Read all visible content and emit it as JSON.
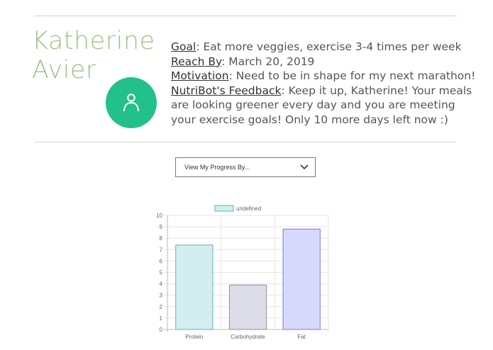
{
  "profile": {
    "first_name": "Katherine",
    "last_name": "Avier",
    "avatar_icon": "user-icon"
  },
  "info": {
    "goal_label": "Goal",
    "goal_value": ": Eat more veggies, exercise 3-4 times per week",
    "reach_label": "Reach By",
    "reach_value": ": March 20, 2019",
    "motivation_label": "Motivation",
    "motivation_value": ": Need to be in shape for my next marathon!",
    "feedback_label": "NutriBot's Feedback",
    "feedback_line1": ": Keep it up, Katherine! Your meals",
    "feedback_line2": "are looking greener every day and you are meeting",
    "feedback_line3": "your exercise goals! Only 10 more days left now :)"
  },
  "progress_select": {
    "value": "View My Progress By...",
    "icon": "chevron-down-icon"
  },
  "chart_data": {
    "type": "bar",
    "categories": [
      "Protein",
      "Carbohydrate",
      "Fat"
    ],
    "series": [
      {
        "name": "undefined",
        "values": [
          7.4,
          3.9,
          8.8
        ]
      }
    ],
    "ylim": [
      0,
      10
    ],
    "yticks": [
      "0",
      "1",
      "2",
      "3",
      "4",
      "5",
      "6",
      "7",
      "8",
      "9",
      "10"
    ],
    "legend": "top",
    "grid": true,
    "colors": {
      "fills": [
        "#d4eef0",
        "#dddde8",
        "#d6d9fb"
      ],
      "strokes": [
        "#58b4bf",
        "#8e8ea8",
        "#7579e8"
      ],
      "legend_fill": "#d4eef0",
      "legend_stroke": "#58b4bf"
    }
  }
}
